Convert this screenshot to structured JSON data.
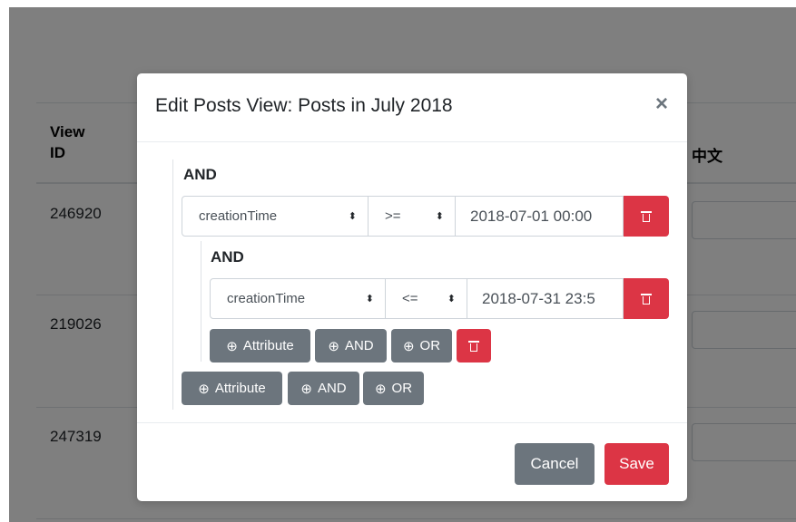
{
  "table": {
    "headers": {
      "view_id": [
        "View",
        "ID"
      ],
      "lang": "中文"
    },
    "rows": [
      "246920",
      "219026",
      "247319"
    ]
  },
  "modal": {
    "title": "Edit Posts View: Posts in July 2018",
    "close_glyph": "×",
    "outer_group": {
      "operator_label": "AND",
      "condition": {
        "attribute": "creationTime",
        "operator": ">=",
        "value": "2018-07-01 00:00"
      },
      "inner_group": {
        "operator_label": "AND",
        "condition": {
          "attribute": "creationTime",
          "operator": "<=",
          "value": "2018-07-31 23:5"
        },
        "buttons": {
          "attribute": "Attribute",
          "and": "AND",
          "or": "OR"
        }
      },
      "buttons": {
        "attribute": "Attribute",
        "and": "AND",
        "or": "OR"
      }
    },
    "footer": {
      "cancel": "Cancel",
      "save": "Save"
    }
  },
  "icons": {
    "plus": "⊕",
    "sort_arrows": "⬍",
    "trash": "trash-icon"
  },
  "colors": {
    "danger": "#dc3545",
    "secondary": "#6c757d",
    "backdrop": "rgba(0,0,0,0.5)"
  }
}
